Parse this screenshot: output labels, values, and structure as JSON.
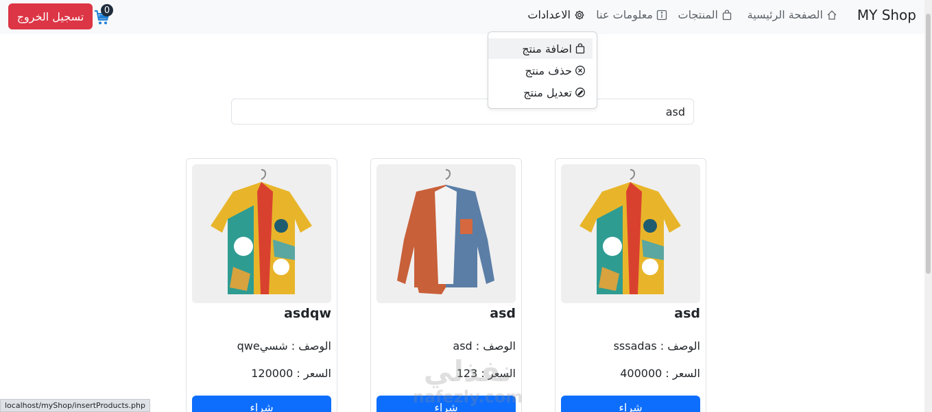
{
  "navbar": {
    "brand": "MY Shop",
    "items": [
      {
        "label": "الصفحة الرئيسية",
        "icon": "house-icon"
      },
      {
        "label": "المنتجات",
        "icon": "bag-icon"
      },
      {
        "label": "معلومات عنا",
        "icon": "info-square-icon"
      },
      {
        "label": "الاعدادات",
        "icon": "gear-icon"
      }
    ],
    "cart_count": "0",
    "logout_label": "تسجيل الخروج"
  },
  "settings_menu": {
    "items": [
      {
        "label": "اضافة منتج",
        "icon": "bag-icon"
      },
      {
        "label": "حذف منتج",
        "icon": "x-circle-icon"
      },
      {
        "label": "تعديل منتج",
        "icon": "edit-circle-icon"
      }
    ]
  },
  "search": {
    "value": "asd"
  },
  "products": [
    {
      "title": "asd",
      "desc": "الوصف : sssadas",
      "price": "السعر : 400000",
      "buy_label": "شراء",
      "image": "floral-shirt"
    },
    {
      "title": "asd",
      "desc": "الوصف : asd",
      "price": "السعر : 123",
      "buy_label": "شراء",
      "image": "two-tone-shirt"
    },
    {
      "title": "asdqw",
      "desc": "الوصف : شسيqwe",
      "price": "السعر : 120000",
      "buy_label": "شراء",
      "image": "floral-shirt"
    }
  ],
  "status_bar": {
    "url": "localhost/myShop/insertProducts.php"
  },
  "watermark": {
    "arabic": "نفذلي",
    "latin": "nafezly.com"
  },
  "colors": {
    "danger": "#dc3545",
    "primary": "#0d6efd",
    "navbar_bg": "#f8f9fa"
  }
}
